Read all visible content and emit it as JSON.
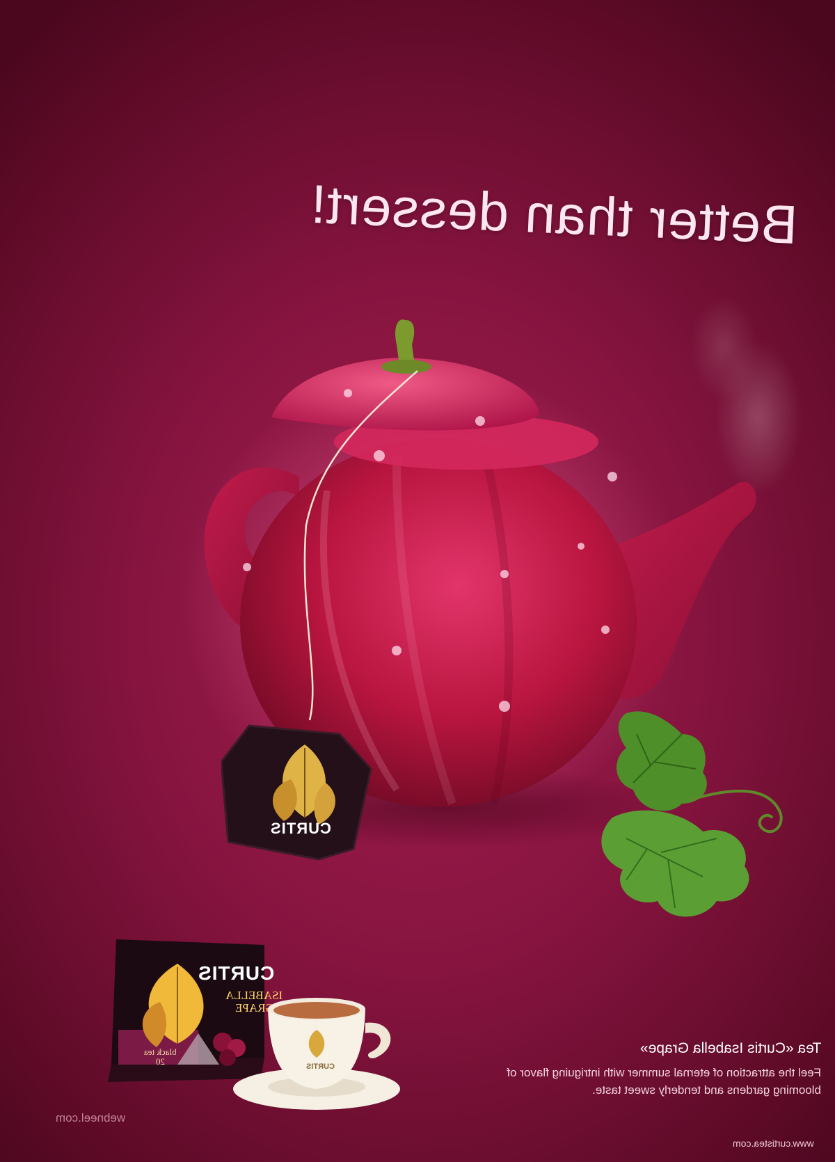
{
  "ad": {
    "headline": "Better than dessert!",
    "tea_tag_brand": "CURTIS",
    "box": {
      "brand": "CURTIS",
      "variety_line1": "ISABELLA",
      "variety_line2": "GRAPE",
      "tea_type": "black tea",
      "count": "20"
    },
    "cup_brand": "CURTIS",
    "product_title": "Tea «Curtis Isabella Grape»",
    "product_description": "Feel the attraction of eternal summer with intriguing flavor of blooming gardens and tenderly sweet taste.",
    "website": "www.curtistea.com",
    "watermark": "webneel.com"
  },
  "colors": {
    "background": "#86143f",
    "apple_red": "#c2174a",
    "stem_green": "#7c9a2e",
    "leaf_green": "#4e8f2a",
    "tag_dark": "#241018",
    "gold": "#e0b347"
  },
  "icons": {
    "leaf": "curtis-leaf-logo-icon",
    "grape_leaf": "grape-leaf-icon"
  }
}
